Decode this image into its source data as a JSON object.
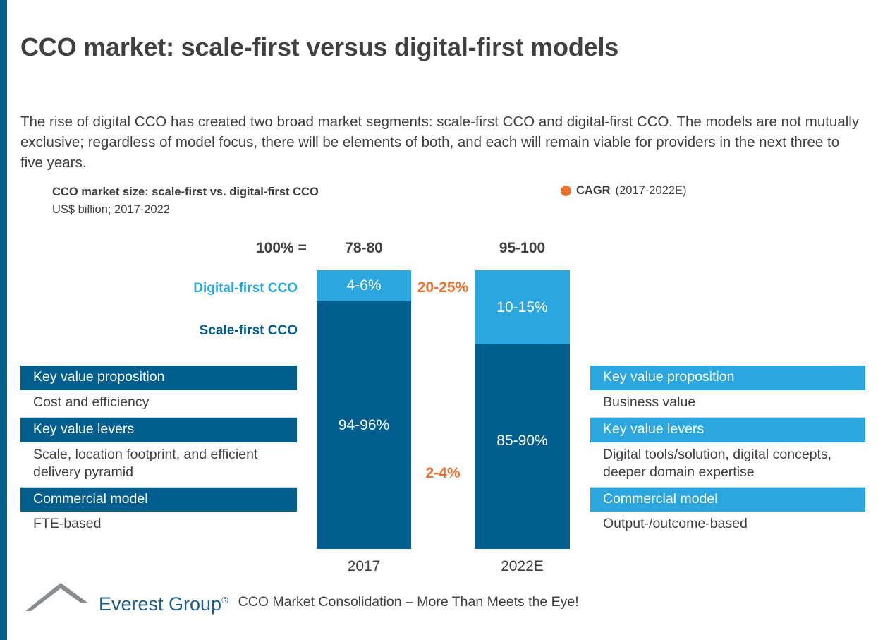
{
  "page": {
    "title": "CCO market: scale-first versus digital-first models",
    "intro": "The rise of digital CCO has created two broad market segments: scale-first CCO and digital-first CCO. The models are not mutually exclusive; regardless of model focus, there will be elements of both, and each will remain viable for providers in the next three to five years.",
    "accent_color": "#015E8F"
  },
  "chart_header": {
    "title": "CCO market size: scale-first vs. digital-first CCO",
    "subtitle": "US$ billion; 2017-2022",
    "legend_label": "CAGR",
    "legend_period": "(2017-2022E)",
    "legend_dot_color": "#E8722E"
  },
  "chart_data": {
    "type": "bar",
    "title": "CCO market size: scale-first vs. digital-first CCO",
    "subtitle": "US$ billion; 2017-2022",
    "xlabel": "",
    "ylabel": "",
    "ylim": [
      0,
      100
    ],
    "grid": false,
    "legend_position": "left-of-plot",
    "stacked": true,
    "categories": [
      "2017",
      "2022E"
    ],
    "totals_prefix": "100% =",
    "totals": [
      "78-80",
      "95-100"
    ],
    "series": [
      {
        "name": "Digital-first CCO",
        "color": "#2BA6DE",
        "labels": [
          "4-6%",
          "10-15%"
        ],
        "values": [
          5,
          12.5
        ],
        "cagr": "20-25%"
      },
      {
        "name": "Scale-first CCO",
        "color": "#015E8F",
        "labels": [
          "94-96%",
          "85-90%"
        ],
        "values": [
          95,
          87.5
        ],
        "cagr": "2-4%"
      }
    ],
    "annotations": [
      {
        "text": "20-25%",
        "color": "#E8722E",
        "series": "Digital-first CCO"
      },
      {
        "text": "2-4%",
        "color": "#E8722E",
        "series": "Scale-first CCO"
      }
    ]
  },
  "panel_left": {
    "accent_color": "#015E8F",
    "rows": [
      {
        "header": "Key value proposition",
        "body": "Cost and efficiency"
      },
      {
        "header": "Key value levers",
        "body": "Scale, location footprint, and efficient delivery pyramid"
      },
      {
        "header": "Commercial model",
        "body": "FTE-based"
      }
    ]
  },
  "panel_right": {
    "accent_color": "#2BA6DE",
    "rows": [
      {
        "header": "Key value proposition",
        "body": "Business value"
      },
      {
        "header": "Key value levers",
        "body": "Digital tools/solution, digital concepts, deeper domain expertise"
      },
      {
        "header": "Commercial model",
        "body": "Output-/outcome-based"
      }
    ]
  },
  "footer": {
    "logo_text": "Everest Group",
    "logo_registered": "®",
    "caption": "CCO Market Consolidation – More Than Meets the Eye!"
  }
}
